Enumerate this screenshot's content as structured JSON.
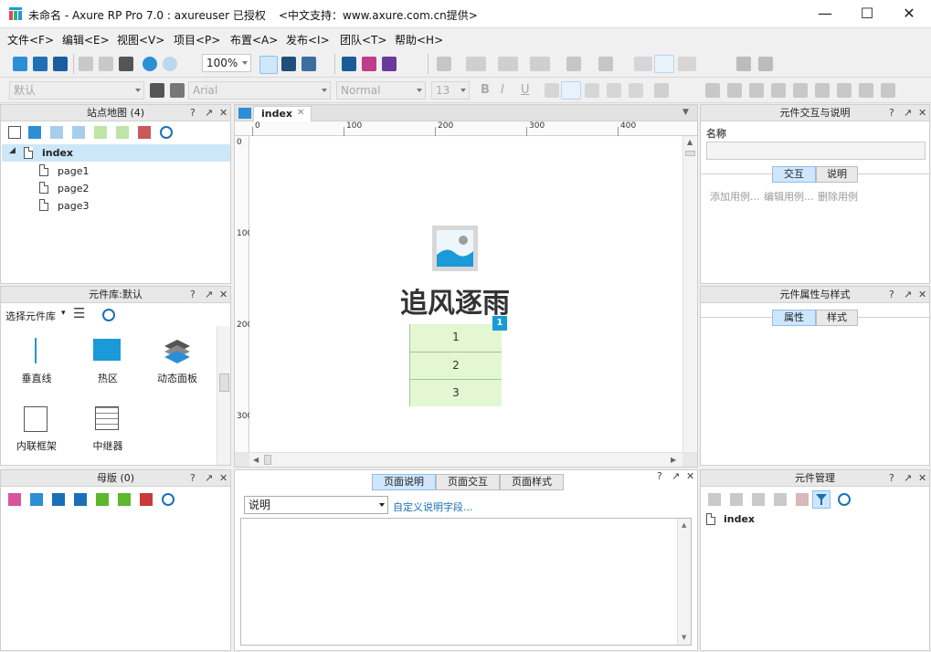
{
  "titlebar": {
    "title": "未命名 - Axure RP Pro 7.0 : axureuser 已授权",
    "support": "<中文支持：www.axure.com.cn提供>",
    "minimize": "—",
    "maximize": "☐",
    "close": "✕"
  },
  "menu": [
    "文件<F>",
    "编辑<E>",
    "视图<V>",
    "项目<P>",
    "布置<A>",
    "发布<I>",
    "团队<T>",
    "帮助<H>"
  ],
  "toolbar": {
    "zoom": "100%",
    "font_style": "默认",
    "font_family": "Arial",
    "font_weight": "Normal",
    "font_size": "13",
    "bold": "B",
    "italic": "I",
    "underline": "U"
  },
  "sitemap": {
    "title": "站点地图 (4)",
    "root": "index",
    "pages": [
      "page1",
      "page2",
      "page3"
    ]
  },
  "panel_controls": {
    "help": "?",
    "pin": "↗",
    "close": "✕"
  },
  "library": {
    "title": "元件库:默认",
    "selector": "选择元件库",
    "widgets": [
      "垂直线",
      "热区",
      "动态面板",
      "内联框架",
      "中继器"
    ]
  },
  "masters": {
    "title": "母版 (0)"
  },
  "canvas": {
    "tab": "index",
    "tab_close": "✕",
    "heading": "追风逐雨",
    "badge": "1",
    "rows": [
      "1",
      "2",
      "3"
    ],
    "ruler_h": [
      "0",
      "100",
      "200",
      "300",
      "400"
    ],
    "ruler_v": [
      "0",
      "100",
      "200",
      "300"
    ]
  },
  "notes": {
    "tabs": [
      "页面说明",
      "页面交互",
      "页面样式"
    ],
    "dropdown": "说明",
    "link": "自定义说明字段..."
  },
  "interaction_panel": {
    "title": "元件交互与说明",
    "name_label": "名称",
    "tabs": [
      "交互",
      "说明"
    ],
    "actions": [
      "添加用例...",
      "编辑用例...",
      "删除用例"
    ]
  },
  "properties_panel": {
    "title": "元件属性与样式",
    "tabs": [
      "属性",
      "样式"
    ]
  },
  "widget_manager": {
    "title": "元件管理",
    "item": "index"
  },
  "colors": {
    "accent": "#2b8fd6",
    "badge": "#1a9ad8",
    "row_fill": "#e3f7d2",
    "row_border": "#9fc69a",
    "selected_row": "#cce8f8"
  }
}
